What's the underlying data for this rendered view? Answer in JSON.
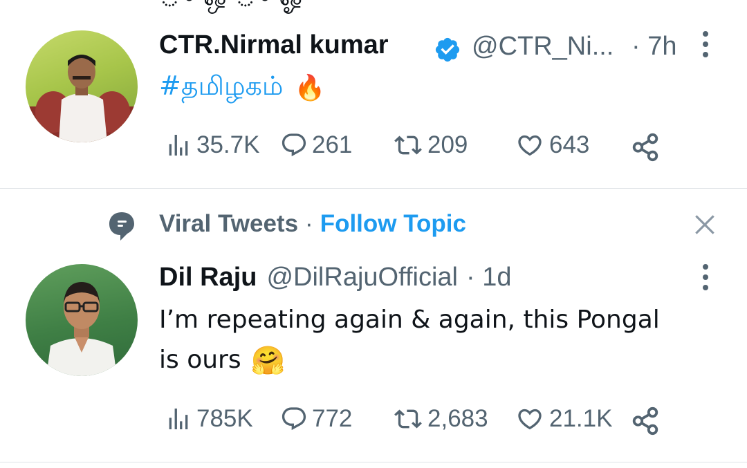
{
  "top_clipped_text": "ு ஒ ு ஓ",
  "tweet1": {
    "author_name": "CTR.Nirmal kumar",
    "verified": true,
    "handle": "@CTR_Ni...",
    "time": "· 7h",
    "hashtag": "#தமிழகம்",
    "emoji": "🔥",
    "stats": {
      "views": "35.7K",
      "replies": "261",
      "retweets": "209",
      "likes": "643"
    }
  },
  "topic": {
    "label": "Viral Tweets",
    "separator": "·",
    "follow_label": "Follow Topic"
  },
  "tweet2": {
    "author_name": "Dil Raju",
    "handle": "@DilRajuOfficial",
    "time": "· 1d",
    "text_line1": "I’m repeating again & again, this Pongal",
    "text_line2": "is ours",
    "emoji": "🤗",
    "stats": {
      "views": "785K",
      "replies": "772",
      "retweets": "2,683",
      "likes": "21.1K"
    }
  },
  "colors": {
    "accent": "#1d9bf0",
    "muted": "#536471",
    "text": "#0f1419",
    "divider": "#dfe3e6"
  },
  "icons": [
    "views-icon",
    "reply-icon",
    "retweet-icon",
    "like-icon",
    "share-icon",
    "more-icon",
    "verified-icon",
    "topic-icon",
    "close-icon"
  ]
}
